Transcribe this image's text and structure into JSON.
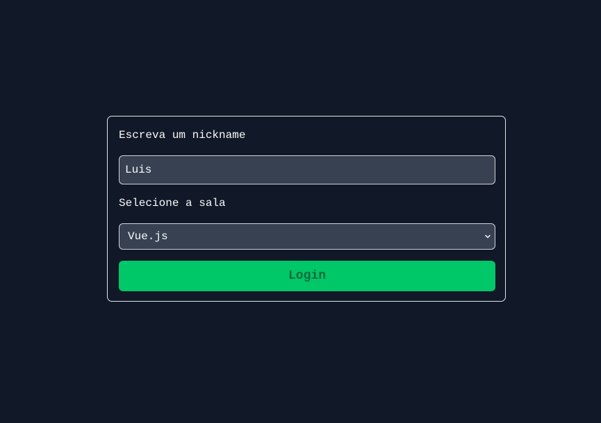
{
  "login_form": {
    "nickname_label": "Escreva um nickname",
    "nickname_value": "Luis",
    "room_label": "Selecione a sala",
    "room_selected": "Vue.js",
    "login_button": "Login"
  },
  "icons": {
    "select_arrow": "chevron-down-icon"
  },
  "colors": {
    "background": "#111827",
    "field_background": "#374151",
    "button": "#00c767",
    "button_text": "#0d6b3b"
  }
}
